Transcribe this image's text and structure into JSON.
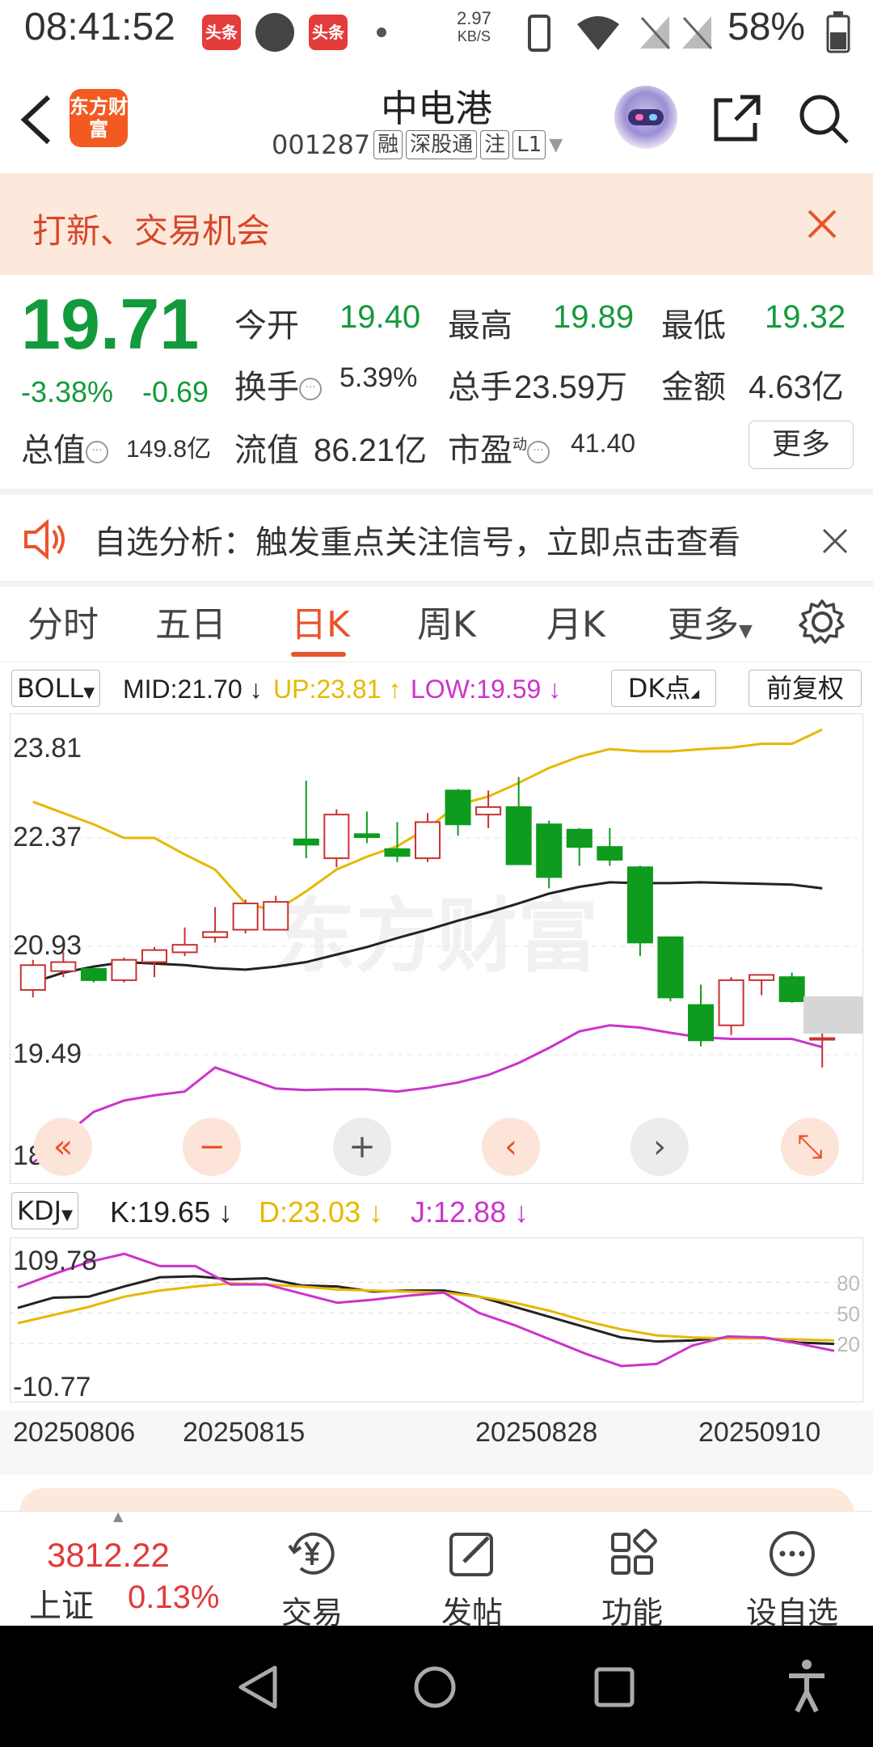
{
  "status_bar": {
    "time": "08:41:52",
    "app_icon_1": "头条",
    "app_icon_2": "头条",
    "net_speed_value": "2.97",
    "net_speed_unit": "KB/S",
    "battery": "58%"
  },
  "header": {
    "logo_text": "东方财富",
    "stock_name": "中电港",
    "stock_code": "001287",
    "tags": [
      "融",
      "深股通",
      "注",
      "L1"
    ]
  },
  "promo": {
    "text": "打新、交易机会"
  },
  "quote": {
    "price": "19.71",
    "change_pct": "-3.38%",
    "change_abs": "-0.69",
    "open_label": "今开",
    "open_value": "19.40",
    "high_label": "最高",
    "high_value": "19.89",
    "low_label": "最低",
    "low_value": "19.32",
    "turnover_label": "换手",
    "turnover_value": "5.39%",
    "volume_label": "总手",
    "volume_value": "23.59万",
    "amount_label": "金额",
    "amount_value": "4.63亿",
    "mktcap_label": "总值",
    "mktcap_value": "149.8亿",
    "float_label": "流值",
    "float_value": "86.21亿",
    "pe_label": "市盈",
    "pe_superscript": "动",
    "pe_value": "41.40",
    "more_label": "更多"
  },
  "notice": {
    "text": "自选分析：触发重点关注信号，立即点击查看"
  },
  "tabs": [
    {
      "label": "分时"
    },
    {
      "label": "五日"
    },
    {
      "label": "日K"
    },
    {
      "label": "周K"
    },
    {
      "label": "月K"
    },
    {
      "label": "更多"
    }
  ],
  "boll": {
    "selector": "BOLL",
    "mid": "MID:21.70",
    "up": "UP:23.81",
    "low": "LOW:19.59",
    "dk_button": "DK点",
    "adjust_button": "前复权",
    "watermark": "东方财富",
    "colors": {
      "mid": "#222222",
      "up": "#e6b800",
      "low": "#cc33cc",
      "rise": "#c83232",
      "fall": "#0e9b1e"
    }
  },
  "kdj": {
    "selector": "KDJ",
    "k": "K:19.65",
    "d": "D:23.03",
    "j": "J:12.88"
  },
  "chart_data": [
    {
      "type": "candlestick",
      "indicator": "BOLL",
      "ylim": [
        18.05,
        23.81
      ],
      "y_ticks": [
        "23.81",
        "22.37",
        "20.93",
        "19.49",
        "18.05"
      ],
      "x_ticks": [
        "20250806",
        "20250815",
        "20250828",
        "20250910"
      ],
      "candles": [
        {
          "o": 20.35,
          "c": 20.68,
          "h": 20.75,
          "l": 20.25
        },
        {
          "o": 20.6,
          "c": 20.72,
          "h": 20.85,
          "l": 20.52
        },
        {
          "o": 20.63,
          "c": 20.48,
          "h": 20.65,
          "l": 20.45
        },
        {
          "o": 20.48,
          "c": 20.75,
          "h": 20.78,
          "l": 20.45
        },
        {
          "o": 20.72,
          "c": 20.88,
          "h": 20.92,
          "l": 20.52
        },
        {
          "o": 20.85,
          "c": 20.95,
          "h": 21.18,
          "l": 20.8
        },
        {
          "o": 21.05,
          "c": 21.12,
          "h": 21.45,
          "l": 20.98
        },
        {
          "o": 21.15,
          "c": 21.5,
          "h": 21.55,
          "l": 21.1
        },
        {
          "o": 21.15,
          "c": 21.52,
          "h": 21.6,
          "l": 21.15
        },
        {
          "o": 22.35,
          "c": 22.28,
          "h": 23.13,
          "l": 22.1
        },
        {
          "o": 22.1,
          "c": 22.68,
          "h": 22.75,
          "l": 21.98
        },
        {
          "o": 22.42,
          "c": 22.38,
          "h": 22.72,
          "l": 22.3
        },
        {
          "o": 22.22,
          "c": 22.13,
          "h": 22.58,
          "l": 22.05
        },
        {
          "o": 22.1,
          "c": 22.58,
          "h": 22.7,
          "l": 22.05
        },
        {
          "o": 23.0,
          "c": 22.55,
          "h": 23.02,
          "l": 22.4
        },
        {
          "o": 22.68,
          "c": 22.78,
          "h": 23.0,
          "l": 22.5
        },
        {
          "o": 22.78,
          "c": 22.02,
          "h": 23.18,
          "l": 22.02
        },
        {
          "o": 22.55,
          "c": 21.85,
          "h": 22.6,
          "l": 21.7
        },
        {
          "o": 22.48,
          "c": 22.25,
          "h": 22.5,
          "l": 22.0
        },
        {
          "o": 22.25,
          "c": 22.08,
          "h": 22.5,
          "l": 22.0
        },
        {
          "o": 21.98,
          "c": 20.98,
          "h": 22.0,
          "l": 20.8
        },
        {
          "o": 21.05,
          "c": 20.25,
          "h": 21.05,
          "l": 20.2
        },
        {
          "o": 20.15,
          "c": 19.68,
          "h": 20.42,
          "l": 19.6
        },
        {
          "o": 19.88,
          "c": 20.48,
          "h": 20.52,
          "l": 19.75
        },
        {
          "o": 20.48,
          "c": 20.55,
          "h": 20.55,
          "l": 20.28
        },
        {
          "o": 20.52,
          "c": 20.2,
          "h": 20.58,
          "l": 20.18
        },
        {
          "o": 19.71,
          "c": 19.71,
          "h": 19.89,
          "l": 19.32
        }
      ],
      "series": [
        {
          "name": "UP",
          "values": [
            22.85,
            22.7,
            22.55,
            22.37,
            22.37,
            22.15,
            21.95,
            21.5,
            21.4,
            21.66,
            21.95,
            22.12,
            22.26,
            22.5,
            22.81,
            22.92,
            23.1,
            23.3,
            23.45,
            23.55,
            23.52,
            23.52,
            23.55,
            23.57,
            23.62,
            23.62,
            23.81
          ]
        },
        {
          "name": "MID",
          "values": [
            20.45,
            20.58,
            20.66,
            20.72,
            20.7,
            20.68,
            20.64,
            20.62,
            20.66,
            20.72,
            20.82,
            20.92,
            21.04,
            21.15,
            21.27,
            21.38,
            21.5,
            21.63,
            21.72,
            21.78,
            21.77,
            21.77,
            21.78,
            21.77,
            21.76,
            21.75,
            21.7
          ]
        },
        {
          "name": "LOW",
          "values": [
            18.05,
            18.4,
            18.73,
            18.88,
            18.95,
            19.0,
            19.32,
            19.18,
            19.04,
            19.02,
            19.03,
            19.03,
            19.0,
            19.05,
            19.12,
            19.22,
            19.38,
            19.58,
            19.8,
            19.88,
            19.85,
            19.78,
            19.72,
            19.7,
            19.7,
            19.7,
            19.59
          ]
        }
      ]
    },
    {
      "type": "line",
      "indicator": "KDJ",
      "ylim": [
        -10.77,
        109.78
      ],
      "y_ticks": [
        "109.78",
        "-10.77"
      ],
      "right_ticks": [
        80,
        50,
        20
      ],
      "series": [
        {
          "name": "K",
          "values": [
            55,
            65,
            66,
            76,
            85,
            86,
            83,
            84,
            77,
            76,
            71,
            72,
            72,
            66,
            56,
            46,
            36,
            26,
            22,
            23,
            26,
            26,
            21,
            19.65
          ]
        },
        {
          "name": "D",
          "values": [
            40,
            48,
            56,
            66,
            72,
            76,
            79,
            78,
            76,
            73,
            72,
            71,
            70,
            66,
            60,
            52,
            42,
            34,
            28,
            26,
            25,
            25,
            24,
            23.03
          ]
        },
        {
          "name": "J",
          "values": [
            75,
            88,
            100,
            108,
            96,
            96,
            78,
            78,
            69,
            60,
            63,
            67,
            70,
            50,
            38,
            24,
            10,
            -2,
            0,
            18,
            27,
            26,
            20,
            12.88
          ]
        }
      ]
    }
  ],
  "bottom_bar": {
    "index_value": "3812.22",
    "index_name": "上证",
    "index_change": "0.13%",
    "items": [
      {
        "label": "交易",
        "icon": "yen-icon"
      },
      {
        "label": "发帖",
        "icon": "edit-icon"
      },
      {
        "label": "功能",
        "icon": "grid-icon"
      },
      {
        "label": "设自选",
        "icon": "more-icon"
      }
    ]
  }
}
